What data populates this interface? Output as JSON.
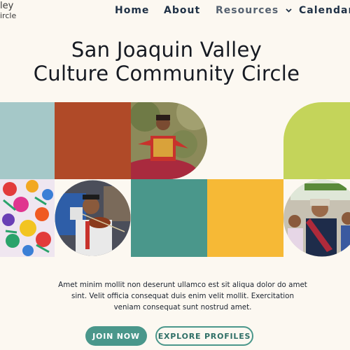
{
  "logo": {
    "line1": "ley",
    "line2": "ircle"
  },
  "nav": {
    "home": "Home",
    "about": "About",
    "resources": "Resources",
    "calendar": "Calendar"
  },
  "hero": {
    "title_line1": "San Joaquin Valley",
    "title_line2": "Culture Community Circle"
  },
  "description": "Amet minim mollit non deserunt ullamco est sit aliqua dolor do amet sint. Velit officia consequat duis enim velit mollit. Exercitation veniam consequat sunt nostrud amet.",
  "buttons": {
    "join": "JOIN NOW",
    "explore": "EXPLORE PROFILES"
  },
  "colors": {
    "background": "#fcf8f1",
    "teal": "#4a978b",
    "light_teal": "#a5c8c8",
    "rust": "#b04a28",
    "gold": "#f6b936",
    "lime": "#c4d45a"
  },
  "images": {
    "dancer": "folkloric-dancer-photo",
    "embroidery": "floral-embroidery-photo",
    "violinist": "violinist-photo",
    "queen": "pageant-queen-photo"
  }
}
